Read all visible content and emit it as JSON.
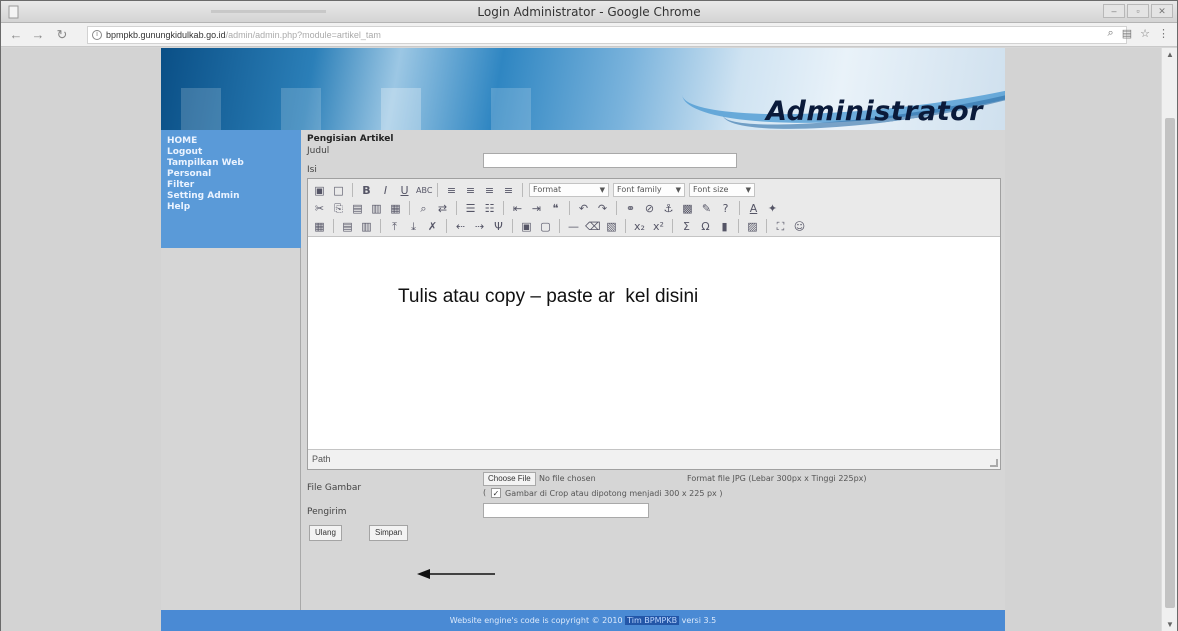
{
  "window": {
    "title": "Login Administrator - Google Chrome"
  },
  "toolbar": {
    "url_host": "bpmpkb.gunungkidulkab.go.id",
    "url_path": "/admin/admin.php?module=artikel_tam"
  },
  "site": {
    "brand": "Administrator",
    "menu": [
      "HOME",
      "Logout",
      "Tampilkan Web",
      "Personal",
      "Filter",
      "Setting Admin",
      "Help"
    ],
    "form": {
      "section_title": "Pengisian Artikel",
      "judul_label": "Judul",
      "judul_value": "",
      "isi_label": "Isi",
      "toolbar_dropdowns": [
        "Format",
        "Font family",
        "Font size"
      ],
      "overlay_text": "Tulis atau copy – paste ar  kel disini",
      "status_path": "Path",
      "file_label": "File Gambar",
      "choose_file": "Choose File",
      "no_file": "No file chosen",
      "format_note": "Format file JPG (Lebar 300px x Tinggi 225px)",
      "crop_note": "Gambar di Crop atau dipotong menjadi 300 x 225 px )",
      "crop_checked": true,
      "pengirim_label": "Pengirim",
      "pengirim_value": "",
      "reset_button": "Ulang",
      "submit_button": "Simpan"
    },
    "footer_text": "Website engine's code is copyright © 2010",
    "footer_link": "Tim BPMPKB",
    "footer_version": "versi 3.5"
  },
  "colors": {
    "menu_bg": "#5a9ad8",
    "footer_bg": "#4a8ad4",
    "page_bg": "#d3d3d3"
  }
}
